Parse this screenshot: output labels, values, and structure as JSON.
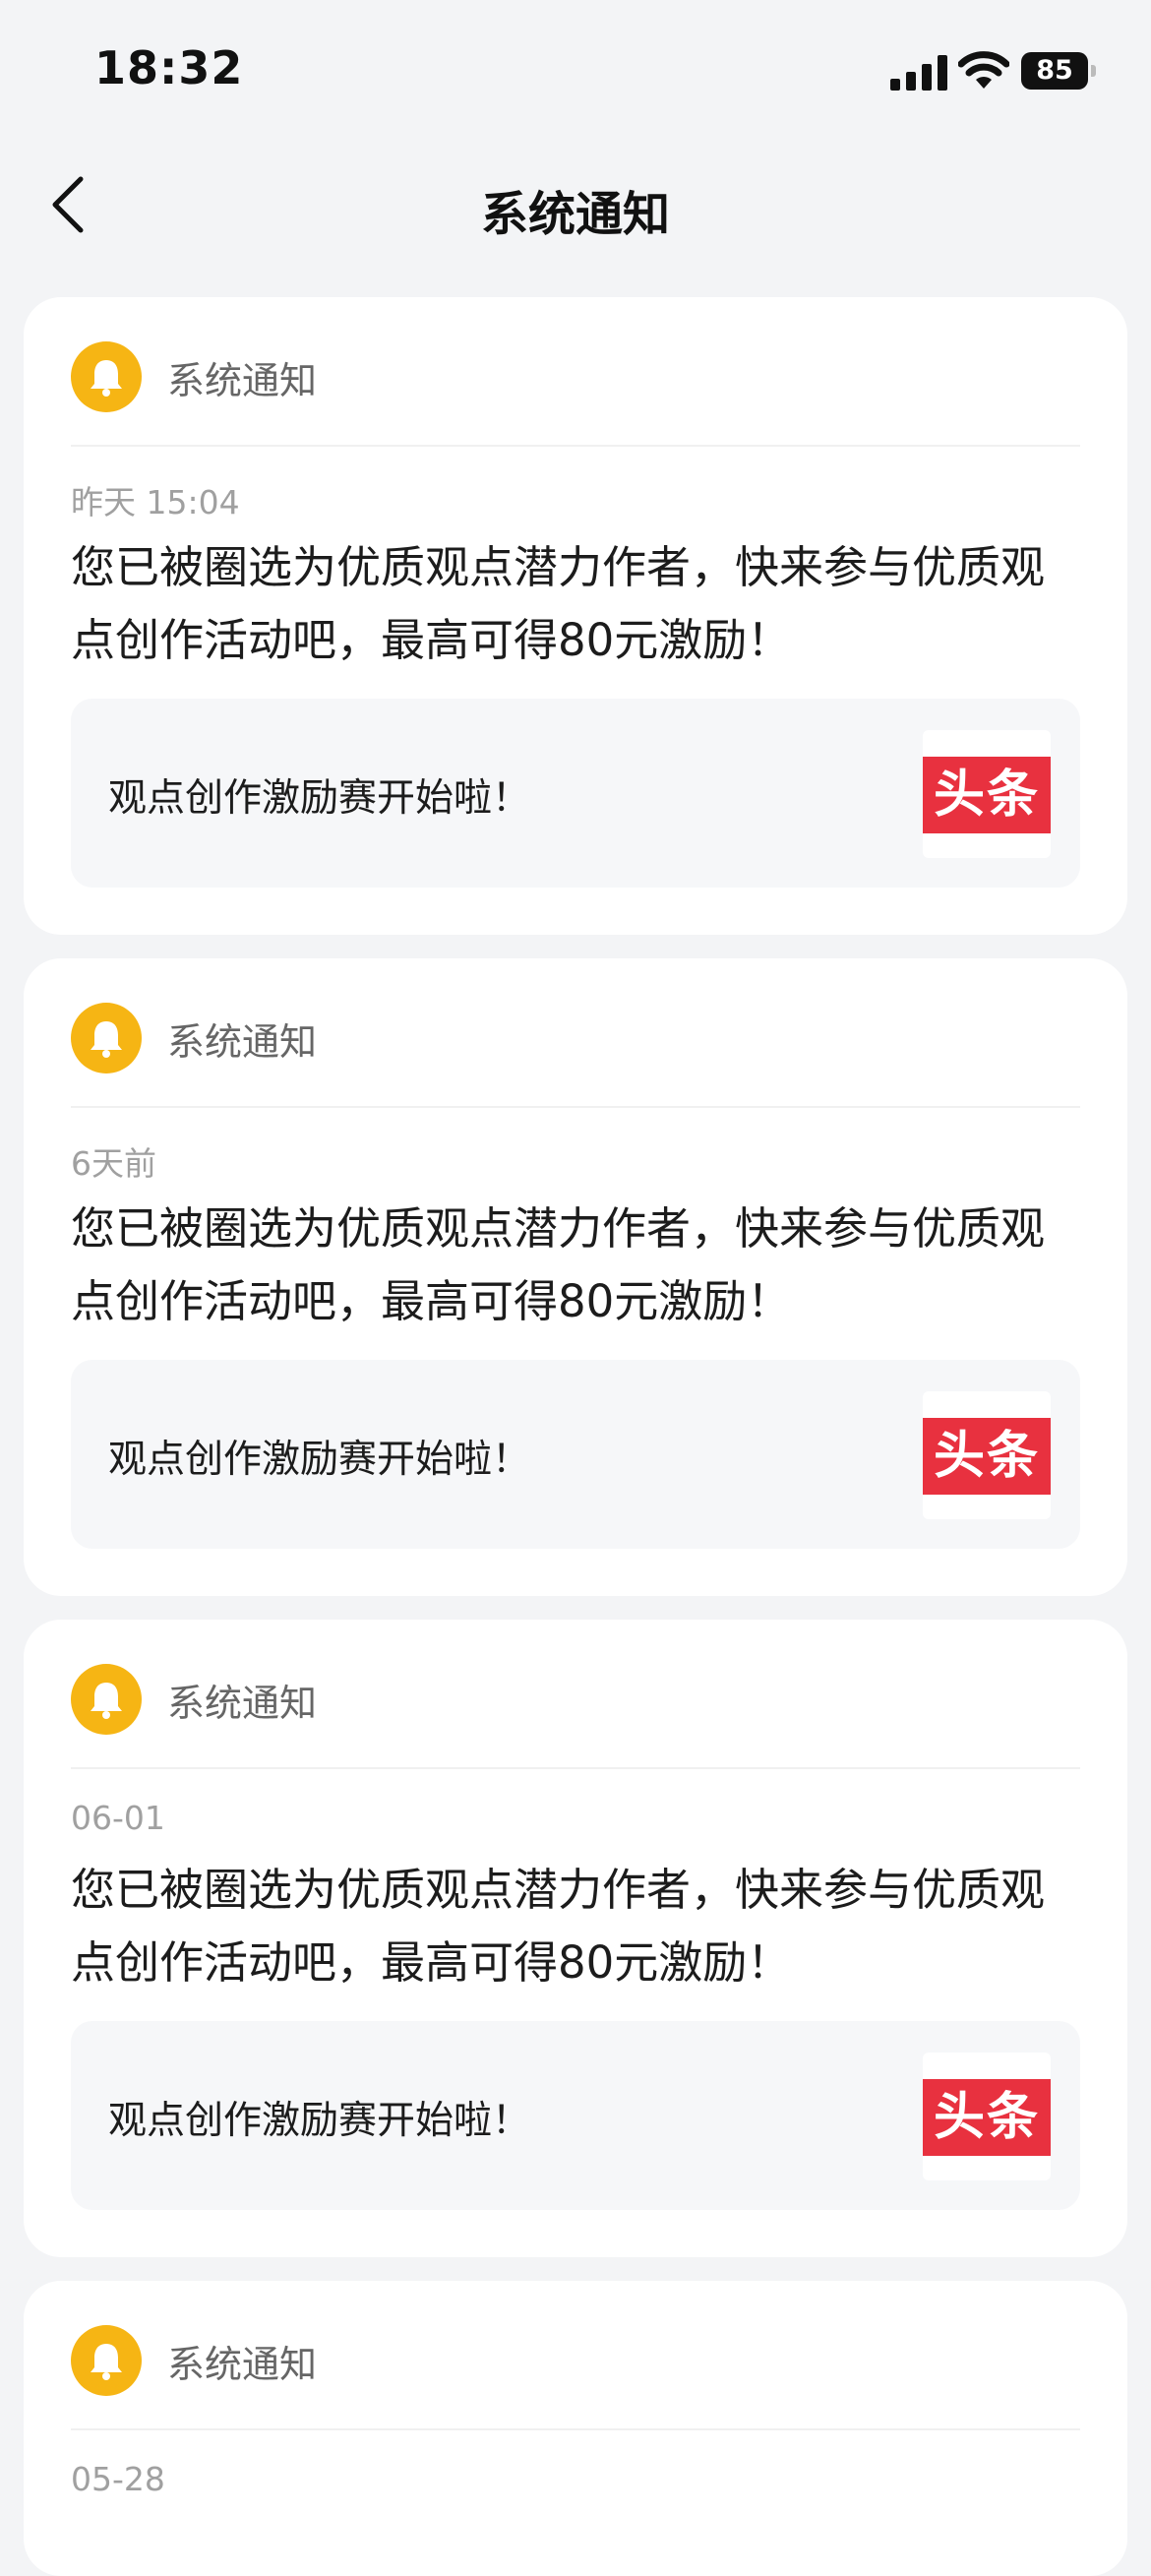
{
  "status_bar": {
    "time": "18:32",
    "battery": "85"
  },
  "nav": {
    "title": "系统通知"
  },
  "notifications": [
    {
      "sender": "系统通知",
      "time": "昨天 15:04",
      "message": "您已被圈选为优质观点潜力作者，快来参与优质观点创作活动吧，最高可得80元激励！",
      "link_text": "观点创作激励赛开始啦！",
      "thumb_logo": "头条"
    },
    {
      "sender": "系统通知",
      "time": "6天前",
      "message": "您已被圈选为优质观点潜力作者，快来参与优质观点创作活动吧，最高可得80元激励！",
      "link_text": "观点创作激励赛开始啦！",
      "thumb_logo": "头条"
    },
    {
      "sender": "系统通知",
      "time": "06-01",
      "message": "您已被圈选为优质观点潜力作者，快来参与优质观点创作活动吧，最高可得80元激励！",
      "link_text": "观点创作激励赛开始啦！",
      "thumb_logo": "头条"
    },
    {
      "sender": "系统通知",
      "time": "05-28"
    }
  ],
  "colors": {
    "accent_bell": "#f6b514",
    "logo_red": "#e8313f",
    "background": "#f3f4f6"
  },
  "icons": {
    "back": "chevron-left-icon",
    "bell": "bell-icon",
    "signal": "signal-icon",
    "wifi": "wifi-icon",
    "battery": "battery-icon"
  }
}
